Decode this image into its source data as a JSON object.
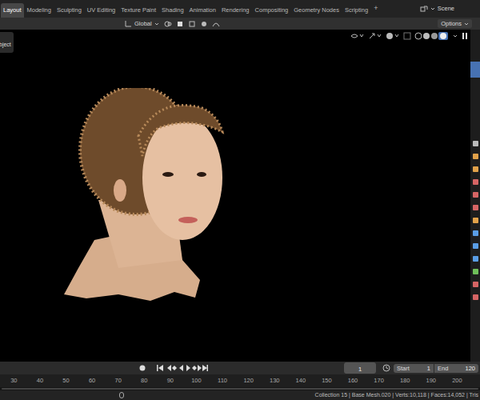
{
  "topbar": {
    "tabs": [
      {
        "label": "Layout",
        "selected": true
      },
      {
        "label": "Modeling",
        "selected": false
      },
      {
        "label": "Sculpting",
        "selected": false
      },
      {
        "label": "UV Editing",
        "selected": false
      },
      {
        "label": "Texture Paint",
        "selected": false
      },
      {
        "label": "Shading",
        "selected": false
      },
      {
        "label": "Animation",
        "selected": false
      },
      {
        "label": "Rendering",
        "selected": false
      },
      {
        "label": "Compositing",
        "selected": false
      },
      {
        "label": "Geometry Nodes",
        "selected": false
      },
      {
        "label": "Scripting",
        "selected": false
      }
    ],
    "add_tab": "+",
    "scene": "Scene"
  },
  "header": {
    "orientation": "Global",
    "options": "Options"
  },
  "viewport": {
    "mode_label": "bject"
  },
  "timeline": {
    "frame": "1",
    "start_label": "Start",
    "start": "1",
    "end_label": "End",
    "end": "120"
  },
  "ruler": {
    "ticks": [
      "30",
      "40",
      "50",
      "60",
      "70",
      "80",
      "90",
      "100",
      "110",
      "120",
      "130",
      "140",
      "150",
      "160",
      "170",
      "180",
      "190",
      "200"
    ]
  },
  "status_bar": {
    "text": "Collection 15 | Base Mesh.020 | Verts:10,118 | Faces:14,052 | Tris"
  }
}
